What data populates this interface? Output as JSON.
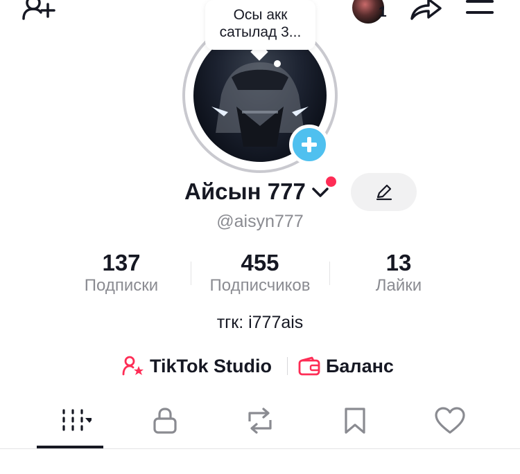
{
  "tooltip": {
    "text": "Осы акк сатылад 3..."
  },
  "header": {
    "notification_count": "1"
  },
  "profile": {
    "display_name": "Айсын 777",
    "username": "@aisyn777",
    "bio": "тгк: i777ais"
  },
  "stats": [
    {
      "value": "137",
      "label": "Подписки"
    },
    {
      "value": "455",
      "label": "Подписчиков"
    },
    {
      "value": "13",
      "label": "Лайки"
    }
  ],
  "links": {
    "studio": "TikTok Studio",
    "balance": "Баланс"
  },
  "tabs": [
    {
      "icon": "grid-icon",
      "active": true
    },
    {
      "icon": "lock-icon",
      "active": false
    },
    {
      "icon": "repost-icon",
      "active": false
    },
    {
      "icon": "bookmark-icon",
      "active": false
    },
    {
      "icon": "heart-icon",
      "active": false
    }
  ],
  "colors": {
    "accent": "#fe2c55",
    "add_button": "#4fc0ef",
    "muted_text": "#8a8b91",
    "primary_text": "#161823"
  }
}
